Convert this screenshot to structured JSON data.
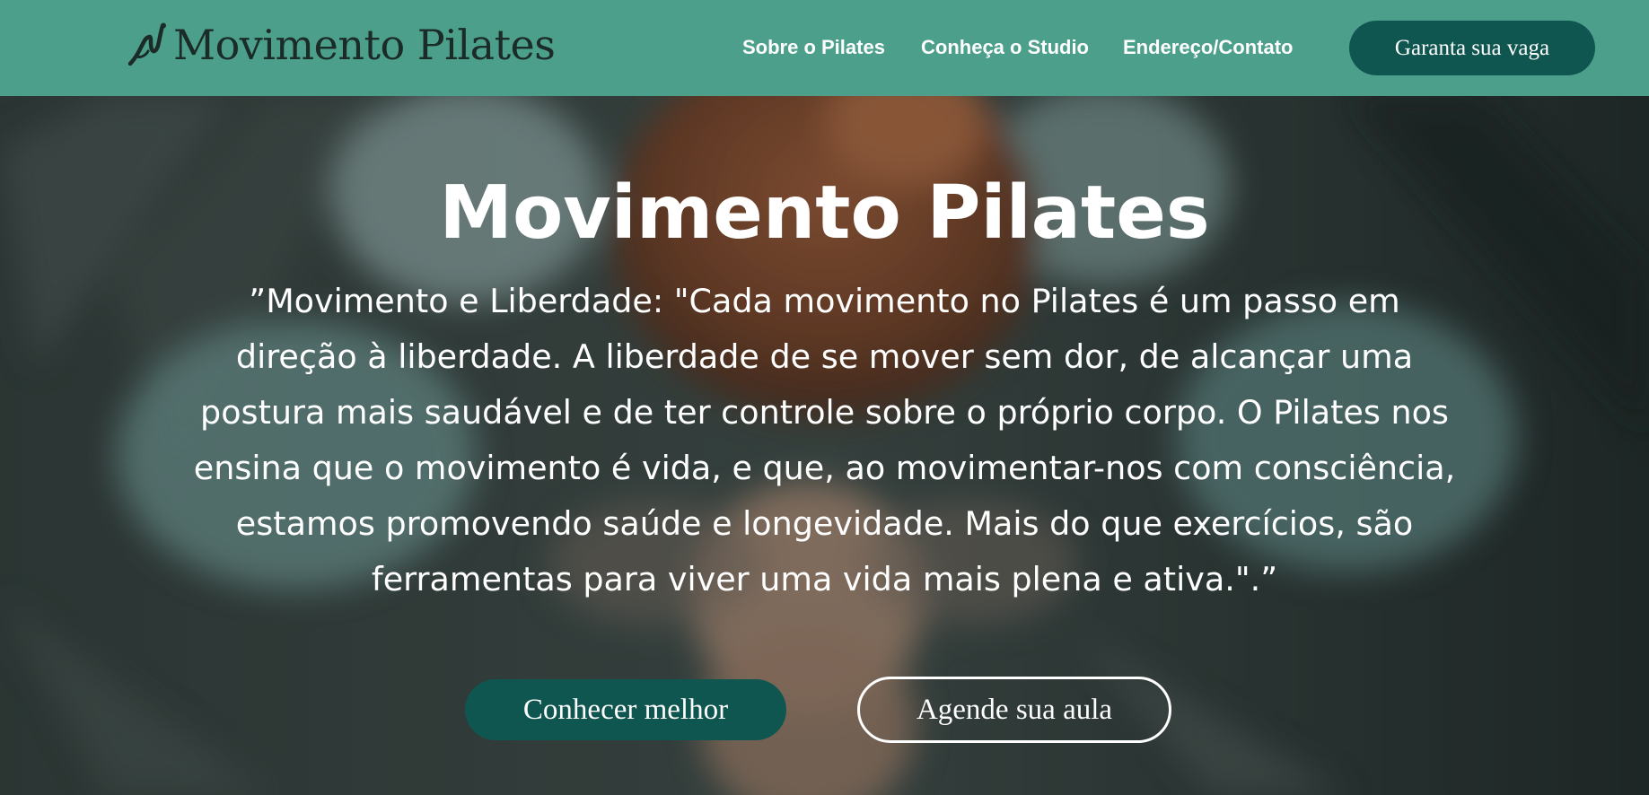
{
  "header": {
    "logo_text": "Movimento Pilates",
    "logo_icon": "pilates-figure-icon",
    "nav": [
      {
        "label": "Sobre o Pilates"
      },
      {
        "label": "Conheça o Studio"
      },
      {
        "label": "Endereço/Contato"
      }
    ],
    "cta_label": "Garanta sua vaga"
  },
  "hero": {
    "title": "Movimento Pilates",
    "quote": "”Movimento e Liberdade: \"Cada movimento no Pilates é um passo em direção à liberdade. A liberdade de se mover sem dor, de alcançar uma postura mais saudável e de ter controle sobre o próprio corpo. O Pilates nos ensina que o movimento é vida, e que, ao movimentar-nos com consciência, estamos promovendo saúde e longevidade. Mais do que exercícios, são ferramentas para viver uma vida mais plena e ativa.\".”",
    "primary_button": "Conhecer melhor",
    "secondary_button": "Agende sua aula"
  },
  "colors": {
    "header_bg": "#4c9f8b",
    "button_dark": "#0f5650",
    "text_light": "#ffffff",
    "logo_text": "#1b2b27"
  }
}
